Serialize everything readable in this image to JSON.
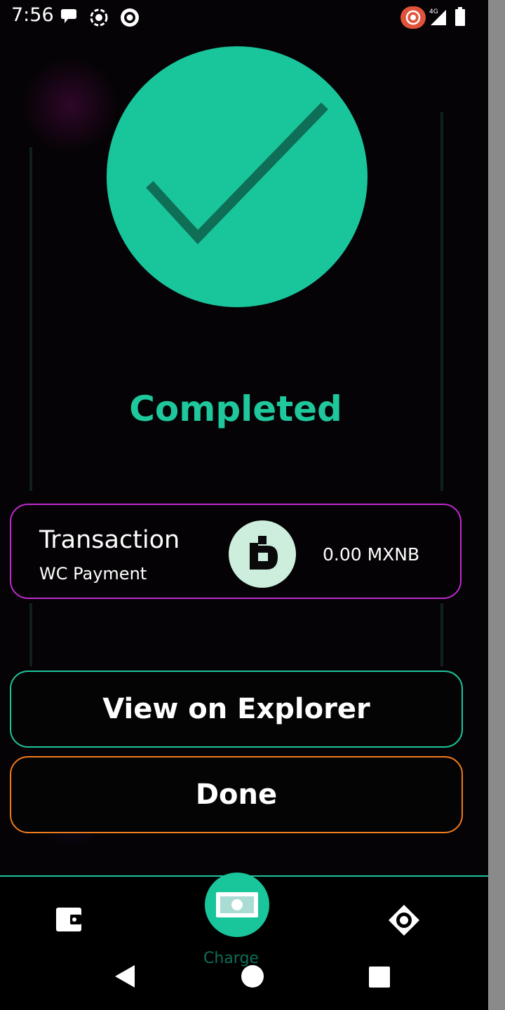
{
  "status_bar": {
    "time": "7:56",
    "icons_left": [
      "chat-bubble-icon",
      "focus-mode-icon",
      "target-icon"
    ],
    "icons_right": [
      "screen-record-icon",
      "signal-4g-icon",
      "battery-icon"
    ],
    "network": "4G"
  },
  "result": {
    "icon": "check-icon",
    "status": "Completed"
  },
  "transaction": {
    "title": "Transaction",
    "subtitle": "WC Payment",
    "token_icon": "mxnb-token-icon",
    "amount": "0.00 MXNB"
  },
  "actions": {
    "view_explorer": "View on Explorer",
    "done": "Done"
  },
  "bottom_nav": {
    "items": [
      {
        "icon": "wallet-icon"
      },
      {
        "icon": "cash-icon",
        "label": "Charge"
      },
      {
        "icon": "settings-eye-icon"
      }
    ]
  },
  "system_nav": [
    "back-icon",
    "home-icon",
    "recents-icon"
  ],
  "colors": {
    "accent_green": "#19c59b",
    "card_border_purple": "#c12ad0",
    "done_border_orange": "#f07a1c"
  }
}
